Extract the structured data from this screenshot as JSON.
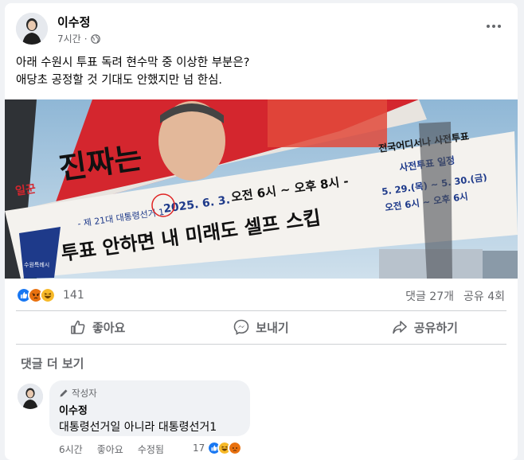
{
  "post": {
    "author": "이수정",
    "time": "7시간",
    "line1": "아래 수원시 투표 독려 현수막 중 이상한 부분은?",
    "line2": "애당초 공정할 것 기대도 안했지만 넘 한심."
  },
  "photo": {
    "banner_top_small": "일꾼",
    "banner_top_big": "진짜는",
    "election_label": "- 제 21대 대통령선거 1",
    "date": "2025. 6. 3.",
    "time_text": "오전 6시 ~ 오후 8시 -",
    "main_slogan": "투표 안하면 내 미래도 셀프 스킵",
    "early_title": "전국어디서나 사전투표",
    "early_sub": "사전투표 일정",
    "early_dates": "5. 29.(목) ~ 5. 30.(금)",
    "early_hours": "오전 6시 ~ 오후 6시",
    "side_org": "수원특례시"
  },
  "stats": {
    "reaction_count": "141",
    "comments": "댓글 27개",
    "shares": "공유 4회"
  },
  "actions": {
    "like": "좋아요",
    "send": "보내기",
    "share": "공유하기"
  },
  "comments_section": {
    "more": "댓글 더 보기",
    "comment": {
      "badge": "작성자",
      "author": "이수정",
      "text": "대통령선거일 아니라 대통령선거1",
      "time": "6시간",
      "like": "좋아요",
      "edited": "수정됨",
      "reaction_count": "17"
    }
  },
  "colors": {
    "like_blue": "#1877f2",
    "haha_yellow": "#f7b928",
    "angry_orange": "#e9710f",
    "banner_red": "#d4262e",
    "banner_navy": "#1e3a8a"
  }
}
